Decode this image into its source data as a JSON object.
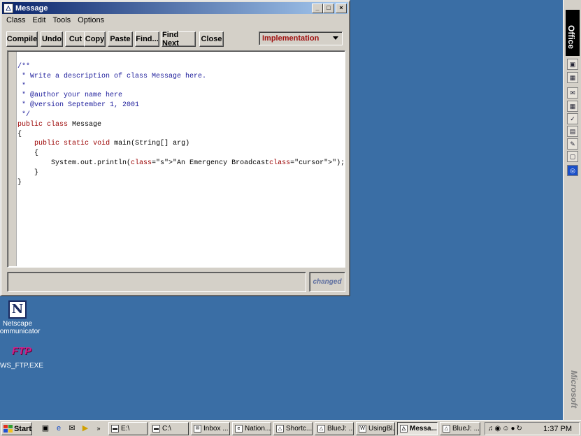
{
  "window": {
    "title": "Message",
    "buttons": {
      "minimize": "_",
      "maximize": "□",
      "close": "×"
    }
  },
  "menu": [
    "Class",
    "Edit",
    "Tools",
    "Options"
  ],
  "toolbar": {
    "compile": "Compile",
    "undo": "Undo",
    "cut": "Cut",
    "copy": "Copy",
    "paste": "Paste",
    "find": "Find...",
    "find_next": "Find Next",
    "close": "Close"
  },
  "view_select": {
    "value": "Implementation"
  },
  "editor": {
    "lines": [
      "/**",
      " * Write a description of class Message here.",
      " *",
      " * @author your name here",
      " * @version September 1, 2001",
      " */",
      "public class Message",
      "{",
      "    public static void main(String[] arg)",
      "    {",
      "        System.out.println(\"An Emergency Broadcast\");",
      "    }",
      "}"
    ]
  },
  "status": {
    "message": "",
    "changed": "changed"
  },
  "desktop_icons": [
    {
      "label_line1": "Netscape",
      "label_line2": "Communicator",
      "icon": "netscape-icon"
    },
    {
      "label_line1": "WS_FTP.EXE",
      "label_line2": "",
      "icon": "ftp-icon"
    }
  ],
  "office_bar": {
    "logo": "Office",
    "brand": "Microsoft"
  },
  "taskbar": {
    "start": "Start",
    "tasks": [
      "E:\\",
      "C:\\",
      "Inbox ...",
      "Nation...",
      "Shortc...",
      "BlueJ: ...",
      "UsingBl...",
      "Messa...",
      "BlueJ: ..."
    ],
    "active_task": "Messa...",
    "clock": "1:37 PM"
  },
  "colors": {
    "desktop": "#3a6ea5",
    "title_active": "#0a246a",
    "keyword": "#9a0000",
    "comment": "#1a1a9a",
    "string": "#006400"
  }
}
